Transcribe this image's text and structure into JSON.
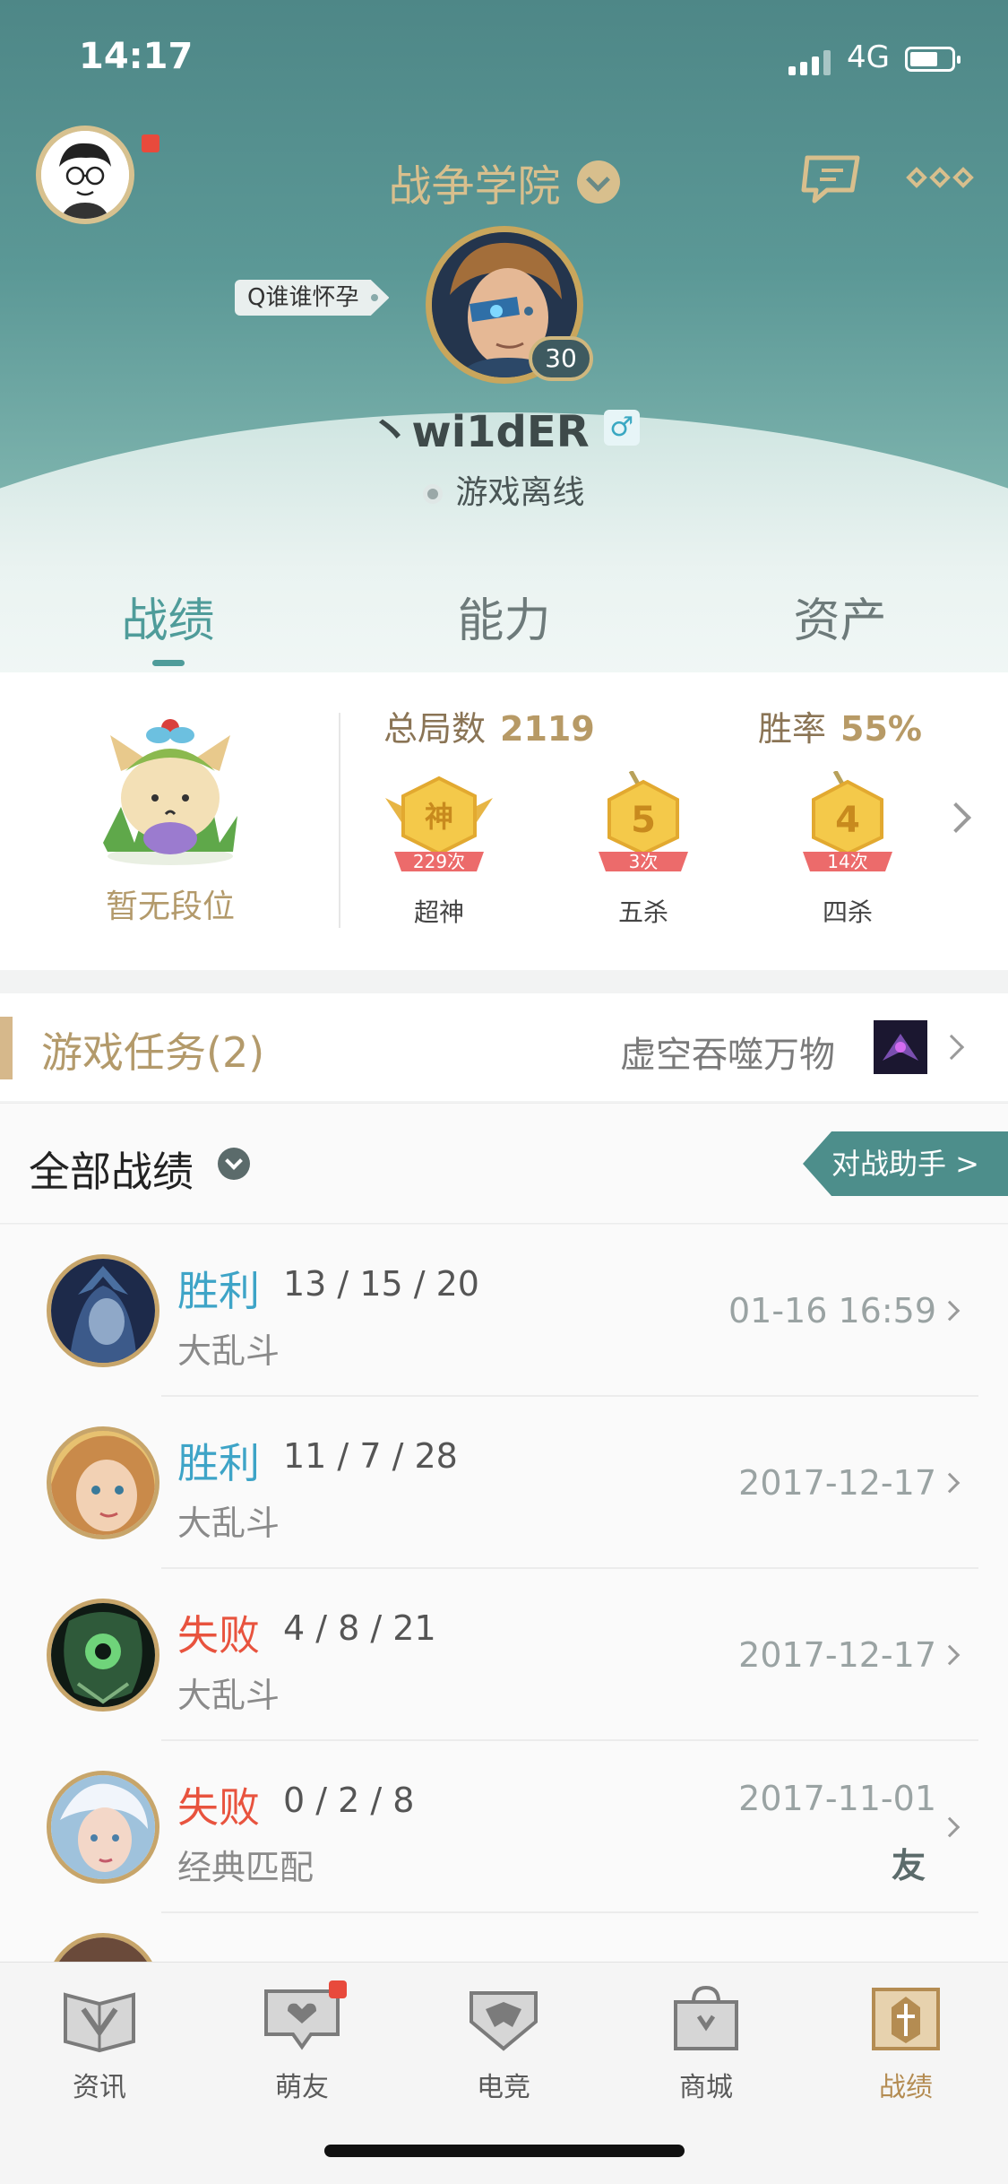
{
  "status_bar": {
    "time": "14:17",
    "network": "4G"
  },
  "header": {
    "server_name": "战争学院",
    "nickname_tag": "Q谁谁怀孕",
    "level": "30",
    "username": "丶wi1dER",
    "gender_symbol": "♂",
    "online_status": "游戏离线"
  },
  "tabs": [
    {
      "label": "战绩",
      "active": true
    },
    {
      "label": "能力",
      "active": false
    },
    {
      "label": "资产",
      "active": false
    }
  ],
  "stats": {
    "rank_label": "暂无段位",
    "total_label": "总局数",
    "total_value": "2119",
    "rate_label": "胜率",
    "rate_value": "55%",
    "medals": [
      {
        "glyph": "神",
        "count": "229次",
        "label": "超神"
      },
      {
        "glyph": "5",
        "count": "3次",
        "label": "五杀"
      },
      {
        "glyph": "4",
        "count": "14次",
        "label": "四杀"
      }
    ]
  },
  "task": {
    "title": "游戏任务(2)",
    "name": "虚空吞噬万物"
  },
  "filter": {
    "label": "全部战绩",
    "assistant_button": "对战助手 >"
  },
  "matches": [
    {
      "result": "胜利",
      "outcome": "win",
      "kda": "13 / 15 / 20",
      "mode": "大乱斗",
      "date": "01-16 16:59",
      "friend": ""
    },
    {
      "result": "胜利",
      "outcome": "win",
      "kda": "11 / 7 / 28",
      "mode": "大乱斗",
      "date": "2017-12-17",
      "friend": ""
    },
    {
      "result": "失败",
      "outcome": "lose",
      "kda": "4 / 8 / 21",
      "mode": "大乱斗",
      "date": "2017-12-17",
      "friend": ""
    },
    {
      "result": "失败",
      "outcome": "lose",
      "kda": "0 / 2 / 8",
      "mode": "经典匹配",
      "date": "2017-11-01",
      "friend": "友"
    }
  ],
  "tabbar": [
    {
      "label": "资讯",
      "active": false,
      "badge": false
    },
    {
      "label": "萌友",
      "active": false,
      "badge": true
    },
    {
      "label": "电竞",
      "active": false,
      "badge": false
    },
    {
      "label": "商城",
      "active": false,
      "badge": false
    },
    {
      "label": "战绩",
      "active": true,
      "badge": false
    }
  ],
  "colors": {
    "teal": "#4f9c9a",
    "gold": "#b79a66",
    "win": "#3ea4c7",
    "lose": "#e8533e"
  }
}
